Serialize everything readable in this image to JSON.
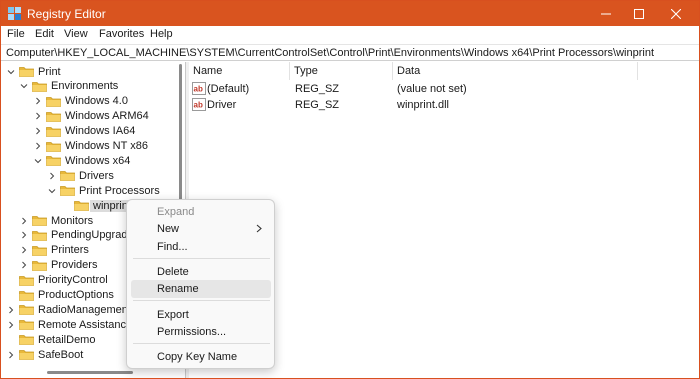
{
  "window": {
    "title": "Registry Editor",
    "accent": "#d9541f"
  },
  "menu": [
    "File",
    "Edit",
    "View",
    "Favorites",
    "Help"
  ],
  "address": "Computer\\HKEY_LOCAL_MACHINE\\SYSTEM\\CurrentControlSet\\Control\\Print\\Environments\\Windows x64\\Print Processors\\winprint",
  "tree": [
    {
      "label": "Print",
      "expanded": true
    },
    {
      "label": "Environments",
      "expanded": true
    },
    {
      "label": "Windows 4.0",
      "expanded": false
    },
    {
      "label": "Windows ARM64",
      "expanded": false
    },
    {
      "label": "Windows IA64",
      "expanded": false
    },
    {
      "label": "Windows NT x86",
      "expanded": false
    },
    {
      "label": "Windows x64",
      "expanded": true
    },
    {
      "label": "Drivers",
      "expanded": false
    },
    {
      "label": "Print Processors",
      "expanded": true
    },
    {
      "label": "winprint",
      "selected": true
    },
    {
      "label": "Monitors",
      "expanded": false
    },
    {
      "label": "PendingUpgrades",
      "expanded": false
    },
    {
      "label": "Printers",
      "expanded": false
    },
    {
      "label": "Providers",
      "expanded": false
    },
    {
      "label": "PriorityControl"
    },
    {
      "label": "ProductOptions"
    },
    {
      "label": "RadioManagement",
      "expanded": false
    },
    {
      "label": "Remote Assistance",
      "expanded": false
    },
    {
      "label": "RetailDemo"
    },
    {
      "label": "SafeBoot",
      "expanded": false
    }
  ],
  "list": {
    "columns": [
      "Name",
      "Type",
      "Data"
    ],
    "rows": [
      {
        "name": "(Default)",
        "type": "REG_SZ",
        "data": "(value not set)"
      },
      {
        "name": "Driver",
        "type": "REG_SZ",
        "data": "winprint.dll"
      }
    ]
  },
  "context_menu": {
    "items": [
      {
        "label": "Expand",
        "disabled": true
      },
      {
        "label": "New",
        "submenu": true
      },
      {
        "label": "Find..."
      },
      {
        "label": "Delete"
      },
      {
        "label": "Rename",
        "hover": true
      },
      {
        "label": "Export"
      },
      {
        "label": "Permissions..."
      },
      {
        "label": "Copy Key Name"
      }
    ]
  },
  "icons": {
    "app": "registry-editor-icon",
    "folder": "folder-icon",
    "value": "string-value-icon",
    "minimize": "minimize-icon",
    "maximize": "maximize-icon",
    "close": "close-icon"
  }
}
